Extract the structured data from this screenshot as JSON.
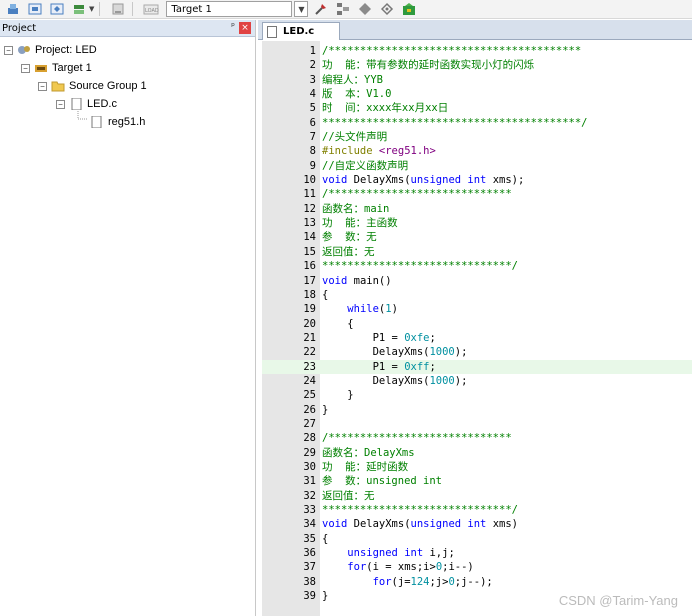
{
  "toolbar": {
    "target_value": "Target 1",
    "icons": [
      "build-icon",
      "rebuild-icon",
      "batch-build-icon",
      "translate-icon",
      "stop-build-icon",
      "load-icon",
      "options-icon",
      "manage-components-icon",
      "select-pack-icon",
      "multi-project-icon",
      "pack-installer-icon"
    ]
  },
  "project_panel": {
    "title": "Project",
    "pin": "ᵖ",
    "close": "×",
    "tree": [
      {
        "label": "Project: LED",
        "level": 0
      },
      {
        "label": "Target 1",
        "level": 1
      },
      {
        "label": "Source Group 1",
        "level": 2
      },
      {
        "label": "LED.c",
        "level": 3
      },
      {
        "label": "reg51.h",
        "level": 4
      }
    ]
  },
  "editor": {
    "tab_label": "LED.c",
    "current_line": 23,
    "lines": [
      {
        "n": "1",
        "tokens": [
          {
            "t": "/****************************************",
            "c": "c-com"
          }
        ]
      },
      {
        "n": "2",
        "tokens": [
          {
            "t": "功  能：带有参数的延时函数实现小灯的闪烁",
            "c": "c-com"
          }
        ]
      },
      {
        "n": "3",
        "tokens": [
          {
            "t": "编程人：YYB",
            "c": "c-com"
          }
        ]
      },
      {
        "n": "4",
        "tokens": [
          {
            "t": "版  本：V1.0",
            "c": "c-com"
          }
        ]
      },
      {
        "n": "5",
        "tokens": [
          {
            "t": "时  间：xxxx年xx月xx日",
            "c": "c-com"
          }
        ]
      },
      {
        "n": "6",
        "tokens": [
          {
            "t": "*****************************************/",
            "c": "c-com"
          }
        ]
      },
      {
        "n": "7",
        "tokens": [
          {
            "t": "//头文件声明",
            "c": "c-com"
          }
        ]
      },
      {
        "n": "8",
        "tokens": [
          {
            "t": "#include ",
            "c": "c-pre"
          },
          {
            "t": "<reg51.h>",
            "c": "c-str"
          }
        ]
      },
      {
        "n": "9",
        "tokens": [
          {
            "t": "//自定义函数声明",
            "c": "c-com"
          }
        ]
      },
      {
        "n": "10",
        "tokens": [
          {
            "t": "void",
            "c": "c-kw"
          },
          {
            "t": " DelayXms(",
            "c": "c-norm"
          },
          {
            "t": "unsigned int",
            "c": "c-kw"
          },
          {
            "t": " xms);",
            "c": "c-norm"
          }
        ]
      },
      {
        "n": "11",
        "tokens": [
          {
            "t": "/*****************************",
            "c": "c-com"
          }
        ]
      },
      {
        "n": "12",
        "tokens": [
          {
            "t": "函数名：main",
            "c": "c-com"
          }
        ]
      },
      {
        "n": "13",
        "tokens": [
          {
            "t": "功  能：主函数",
            "c": "c-com"
          }
        ]
      },
      {
        "n": "14",
        "tokens": [
          {
            "t": "参  数：无",
            "c": "c-com"
          }
        ]
      },
      {
        "n": "15",
        "tokens": [
          {
            "t": "返回值：无",
            "c": "c-com"
          }
        ]
      },
      {
        "n": "16",
        "tokens": [
          {
            "t": "******************************/",
            "c": "c-com"
          }
        ]
      },
      {
        "n": "17",
        "tokens": [
          {
            "t": "void",
            "c": "c-kw"
          },
          {
            "t": " main()",
            "c": "c-norm"
          }
        ]
      },
      {
        "n": "18",
        "tokens": [
          {
            "t": "{",
            "c": "c-norm"
          }
        ]
      },
      {
        "n": "19",
        "tokens": [
          {
            "t": "    ",
            "c": "c-norm"
          },
          {
            "t": "while",
            "c": "c-kw"
          },
          {
            "t": "(",
            "c": "c-norm"
          },
          {
            "t": "1",
            "c": "c-num"
          },
          {
            "t": ")",
            "c": "c-norm"
          }
        ]
      },
      {
        "n": "20",
        "tokens": [
          {
            "t": "    {",
            "c": "c-norm"
          }
        ]
      },
      {
        "n": "21",
        "tokens": [
          {
            "t": "        P1 = ",
            "c": "c-norm"
          },
          {
            "t": "0xfe",
            "c": "c-num"
          },
          {
            "t": ";",
            "c": "c-norm"
          }
        ]
      },
      {
        "n": "22",
        "tokens": [
          {
            "t": "        DelayXms(",
            "c": "c-norm"
          },
          {
            "t": "1000",
            "c": "c-num"
          },
          {
            "t": ");",
            "c": "c-norm"
          }
        ]
      },
      {
        "n": "23",
        "tokens": [
          {
            "t": "        P1 = ",
            "c": "c-norm"
          },
          {
            "t": "0xff",
            "c": "c-num"
          },
          {
            "t": ";",
            "c": "c-norm"
          }
        ]
      },
      {
        "n": "24",
        "tokens": [
          {
            "t": "        DelayXms(",
            "c": "c-norm"
          },
          {
            "t": "1000",
            "c": "c-num"
          },
          {
            "t": ");",
            "c": "c-norm"
          }
        ]
      },
      {
        "n": "25",
        "tokens": [
          {
            "t": "    }",
            "c": "c-norm"
          }
        ]
      },
      {
        "n": "26",
        "tokens": [
          {
            "t": "}",
            "c": "c-norm"
          }
        ]
      },
      {
        "n": "27",
        "tokens": []
      },
      {
        "n": "28",
        "tokens": [
          {
            "t": "/*****************************",
            "c": "c-com"
          }
        ]
      },
      {
        "n": "29",
        "tokens": [
          {
            "t": "函数名：DelayXms",
            "c": "c-com"
          }
        ]
      },
      {
        "n": "30",
        "tokens": [
          {
            "t": "功  能：延时函数",
            "c": "c-com"
          }
        ]
      },
      {
        "n": "31",
        "tokens": [
          {
            "t": "参  数：unsigned int",
            "c": "c-com"
          }
        ]
      },
      {
        "n": "32",
        "tokens": [
          {
            "t": "返回值：无",
            "c": "c-com"
          }
        ]
      },
      {
        "n": "33",
        "tokens": [
          {
            "t": "******************************/",
            "c": "c-com"
          }
        ]
      },
      {
        "n": "34",
        "tokens": [
          {
            "t": "void",
            "c": "c-kw"
          },
          {
            "t": " DelayXms(",
            "c": "c-norm"
          },
          {
            "t": "unsigned int",
            "c": "c-kw"
          },
          {
            "t": " xms)",
            "c": "c-norm"
          }
        ]
      },
      {
        "n": "35",
        "tokens": [
          {
            "t": "{",
            "c": "c-norm"
          }
        ]
      },
      {
        "n": "36",
        "tokens": [
          {
            "t": "    ",
            "c": "c-norm"
          },
          {
            "t": "unsigned int",
            "c": "c-kw"
          },
          {
            "t": " i,j;",
            "c": "c-norm"
          }
        ]
      },
      {
        "n": "37",
        "tokens": [
          {
            "t": "    ",
            "c": "c-norm"
          },
          {
            "t": "for",
            "c": "c-kw"
          },
          {
            "t": "(i = xms;i>",
            "c": "c-norm"
          },
          {
            "t": "0",
            "c": "c-num"
          },
          {
            "t": ";i--)",
            "c": "c-norm"
          }
        ]
      },
      {
        "n": "38",
        "tokens": [
          {
            "t": "        ",
            "c": "c-norm"
          },
          {
            "t": "for",
            "c": "c-kw"
          },
          {
            "t": "(j=",
            "c": "c-norm"
          },
          {
            "t": "124",
            "c": "c-num"
          },
          {
            "t": ";j>",
            "c": "c-norm"
          },
          {
            "t": "0",
            "c": "c-num"
          },
          {
            "t": ";j--);",
            "c": "c-norm"
          }
        ]
      },
      {
        "n": "39",
        "tokens": [
          {
            "t": "}",
            "c": "c-norm"
          }
        ]
      }
    ]
  },
  "watermark": "CSDN @Tarim-Yang"
}
